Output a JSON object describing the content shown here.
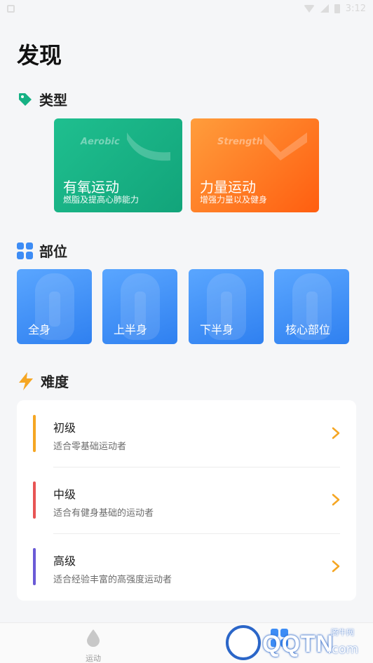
{
  "status_bar": {
    "time": "3:12"
  },
  "page_title": "发现",
  "sections": {
    "type": {
      "label": "类型"
    },
    "parts": {
      "label": "部位"
    },
    "difficulty": {
      "label": "难度"
    }
  },
  "type_cards": [
    {
      "en": "Aerobic",
      "name": "有氧运动",
      "desc": "燃脂及提高心肺能力"
    },
    {
      "en": "Strength",
      "name": "力量运动",
      "desc": "增强力量以及健身"
    }
  ],
  "part_cards": [
    {
      "name": "全身"
    },
    {
      "name": "上半身"
    },
    {
      "name": "下半身"
    },
    {
      "name": "核心部位"
    }
  ],
  "difficulty_items": [
    {
      "title": "初级",
      "sub": "适合零基础运动者",
      "color": "#f5a623"
    },
    {
      "title": "中级",
      "sub": "适合有健身基础的运动者",
      "color": "#e85454"
    },
    {
      "title": "高级",
      "sub": "适合经验丰富的高强度运动者",
      "color": "#6a5ad6"
    }
  ],
  "tabbar": {
    "tabs": [
      {
        "label": "运动",
        "icon": "drop-icon"
      },
      {
        "label": "",
        "icon": "grid-icon"
      }
    ]
  },
  "watermark": {
    "text": "QQTN",
    "cn": "腾牛网",
    "com": ".com"
  },
  "colors": {
    "aerobic": "#16b184",
    "strength": "#ff6f1c",
    "parts": "#3d8cf5",
    "chevron": "#f5a623"
  }
}
